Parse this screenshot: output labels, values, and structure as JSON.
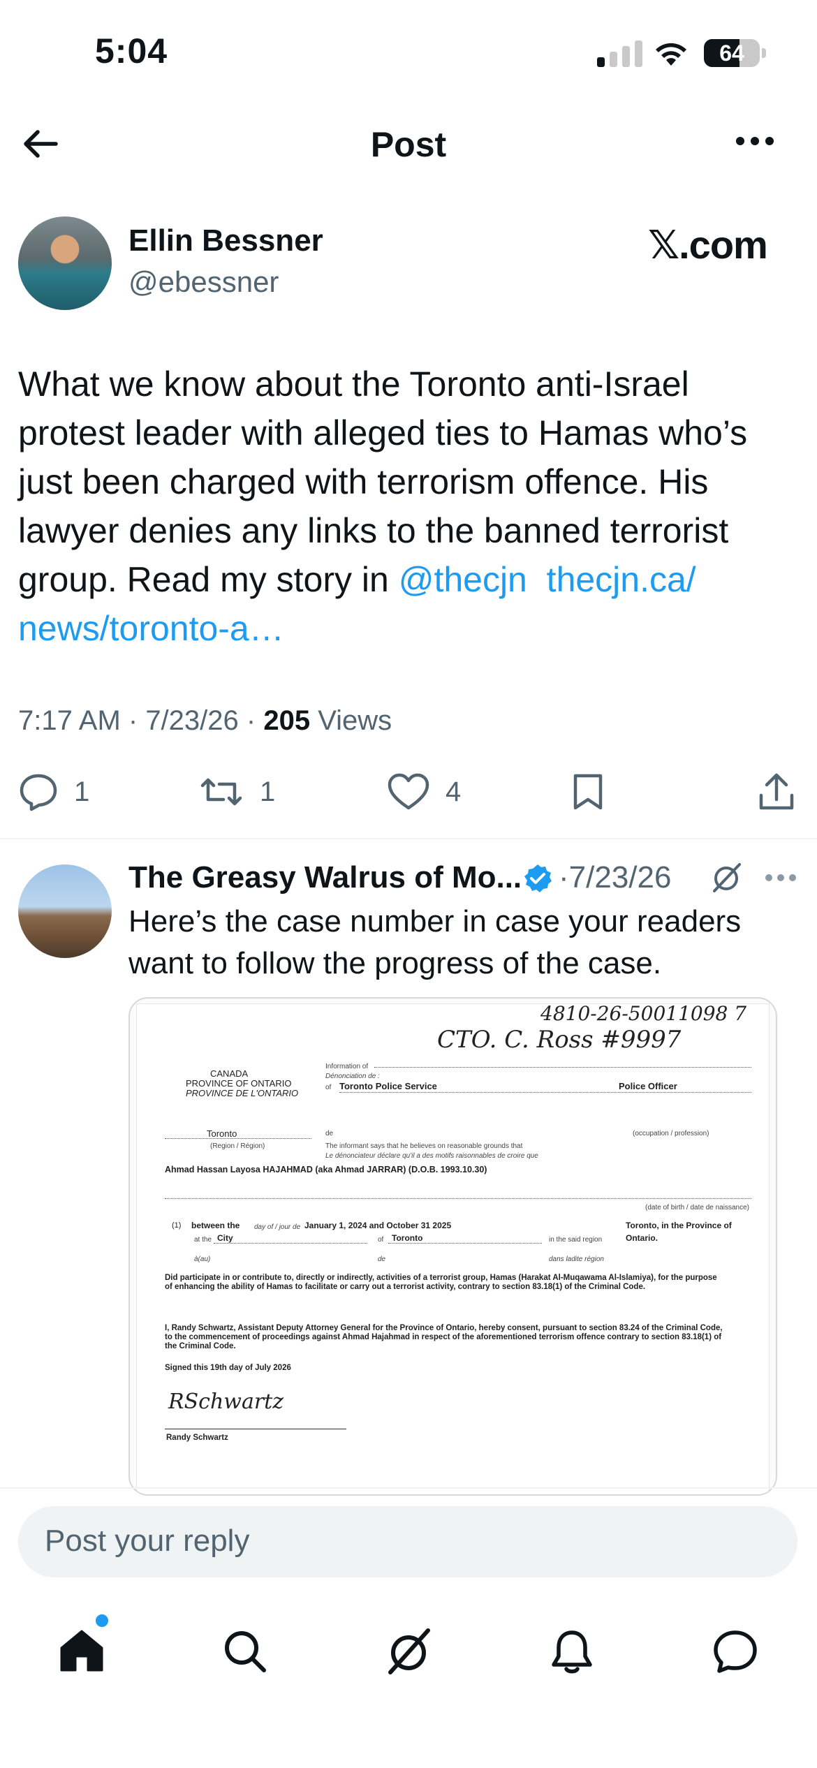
{
  "status_bar": {
    "time": "5:04",
    "battery_percent": "64",
    "battery_level": 0.64,
    "signal_bars_active": 1
  },
  "header": {
    "title": "Post"
  },
  "post": {
    "author_name": "Ellin Bessner",
    "author_handle": "@ebessner",
    "brand": "𝕏.com",
    "text_main": "What we know about the Toronto anti-Israel protest leader with alleged ties to Hamas who’s just been charged with terrorism offence. His lawyer denies any links to the banned terrorist group. Read my story in ",
    "mention": "@thecjn",
    "link": "thecjn.ca/ news/toronto-a…",
    "time": "7:17 AM",
    "date": "7/23/26",
    "views_count": "205",
    "views_label": "Views",
    "replies": "1",
    "reposts": "1",
    "likes": "4"
  },
  "reply": {
    "author_name": "The Greasy Walrus of Mo...",
    "date": "7/23/26",
    "text": "Here’s the case number in case your readers want to follow the progress of the case.",
    "document": {
      "case_number": "4810-26-50011098 7",
      "officer_handwriting": "CTO. C. Ross #9997",
      "country": "CANADA",
      "province_en": "PROVINCE OF ONTARIO",
      "province_fr": "PROVINCE DE L'ONTARIO",
      "information_of": "Information of",
      "denonciation": "Dénonciation de :",
      "of": "of",
      "police_service": "Toronto Police Service",
      "officer_title": "Police Officer",
      "occupation": "(occupation / profession)",
      "city": "Toronto",
      "region": "(Region / Région)",
      "de": "de",
      "informant_en": "The informant says that he believes on reasonable grounds that",
      "informant_fr": "Le dénonciateur déclare qu'il a des motifs raisonnables de croire que",
      "accused": "Ahmad Hassan Layosa HAJAHMAD (aka Ahmad JARRAR) (D.O.B. 1993.10.30)",
      "dob_label": "(date of birth / date de naissance)",
      "count_no": "(1)",
      "between": "between  the",
      "day_label": "day of / jour de",
      "dates": "January 1, 2024 and October 31 2025",
      "at_the": "at the",
      "city_label": "City",
      "of2": "of",
      "toronto": "Toronto",
      "in_region": "in the said region",
      "province_loc": "Toronto, in the Province of",
      "ontario": "Ontario.",
      "au": "à(au)",
      "de2": "de",
      "dans": "dans ladite région",
      "charge": "Did participate in or contribute to, directly or indirectly, activities of a terrorist group, Hamas (Harakat Al-Muqawama Al-Islamiya), for the purpose of enhancing the ability of Hamas to facilitate or carry out a terrorist activity, contrary to section 83.18(1) of the Criminal Code.",
      "consent": "I, Randy Schwartz, Assistant Deputy Attorney General for the Province of Ontario, hereby consent, pursuant to section 83.24 of the Criminal Code, to the commencement of proceedings against Ahmad Hajahmad in respect of the aforementioned terrorism offence contrary to section 83.18(1) of the Criminal Code.",
      "signed": "Signed this 19th day of July 2026",
      "signature": "RSchwartz",
      "signer": "Randy Schwartz"
    }
  },
  "composer": {
    "placeholder": "Post your reply"
  },
  "tabs": [
    "home",
    "search",
    "grok",
    "notifications",
    "messages"
  ]
}
